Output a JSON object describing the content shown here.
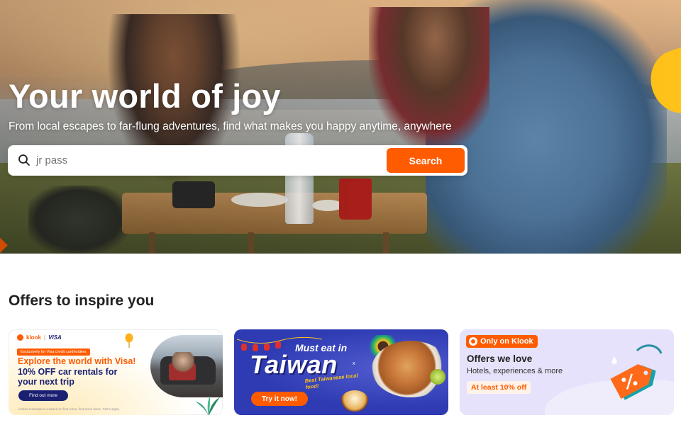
{
  "hero": {
    "title": "Your world of joy",
    "subtitle": "From local escapes to far-flung adventures, find what makes you happy anytime, anywhere"
  },
  "search": {
    "value": "jr pass",
    "button_label": "Search",
    "icon": "search-icon"
  },
  "offers": {
    "section_title": "Offers to inspire you",
    "cards": [
      {
        "brand_left": "klook",
        "brand_right": "VISA",
        "tag": "Exclusively for Visa credit cardholders",
        "headline_line1": "Explore the world with Visa!",
        "headline_line2": "10% OFF car rentals for",
        "headline_line3": "your next trip",
        "button_label": "Find out more",
        "fine_print": "Limited redemption is based on first come, first serve basis. T&Cs apply."
      },
      {
        "kicker": "Must eat in",
        "title": "Taiwan",
        "mark": "x",
        "subtitle": "Best Taiwanese local food!",
        "button_label": "Try it now!"
      },
      {
        "pill_label": "Only on Klook",
        "title": "Offers we love",
        "description": "Hotels, experiences & more",
        "chip": "At least 10% off"
      }
    ]
  },
  "colors": {
    "brand_orange": "#ff5b00",
    "visa_navy": "#1a1f71",
    "taiwan_blue": "#2f3bb3",
    "klook_lavender": "#e6e2fb",
    "accent_yellow": "#ffc21a"
  }
}
